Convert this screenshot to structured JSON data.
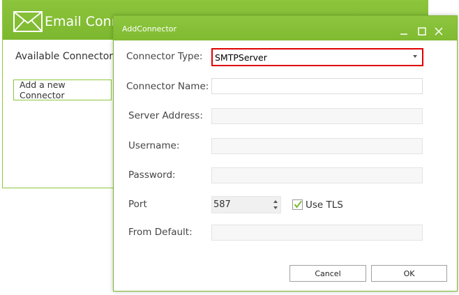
{
  "background_window": {
    "title": "Email Conn",
    "available_label": "Available Connectors",
    "add_button_label": "Add a new Connector"
  },
  "dialog": {
    "title": "AddConnector",
    "connector_type": {
      "label": "Connector Type:",
      "value": "SMTPServer"
    },
    "connector_name": {
      "label": "Connector Name:",
      "value": ""
    },
    "server_address": {
      "label": "Server Address:",
      "value": ""
    },
    "username": {
      "label": "Username:",
      "value": ""
    },
    "password": {
      "label": "Password:",
      "value": ""
    },
    "port": {
      "label": "Port",
      "value": "587"
    },
    "use_tls": {
      "label": "Use TLS",
      "checked": true
    },
    "from_default": {
      "label": "From Default:",
      "value": ""
    },
    "cancel_label": "Cancel",
    "ok_label": "OK"
  },
  "colors": {
    "accent_green": "#8cc43c",
    "highlight_red": "#e00000"
  }
}
